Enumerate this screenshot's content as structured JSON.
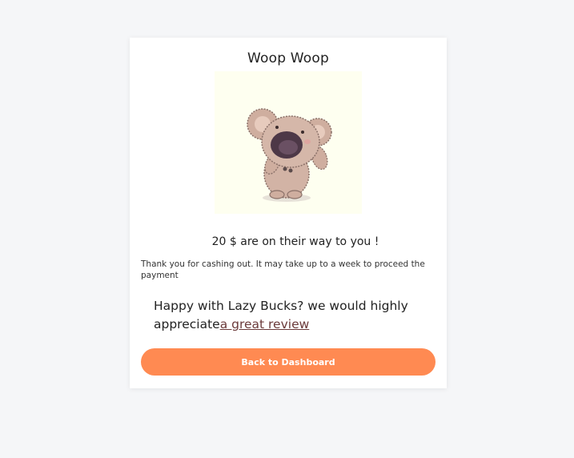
{
  "card": {
    "title": "Woop Woop",
    "illustration": "koala-waving",
    "amount_text": "20 $ are on their way to you !",
    "thanks_text": "Thank you for cashing out. It may take up to a week to proceed the payment",
    "review_prefix": "Happy with Lazy Bucks? we would highly appreciate",
    "review_link": "a great review",
    "back_button_label": "Back to Dashboard"
  },
  "colors": {
    "accent": "#ff8a52",
    "background": "#f5f6f8",
    "illustration_bg": "#fefff0"
  }
}
